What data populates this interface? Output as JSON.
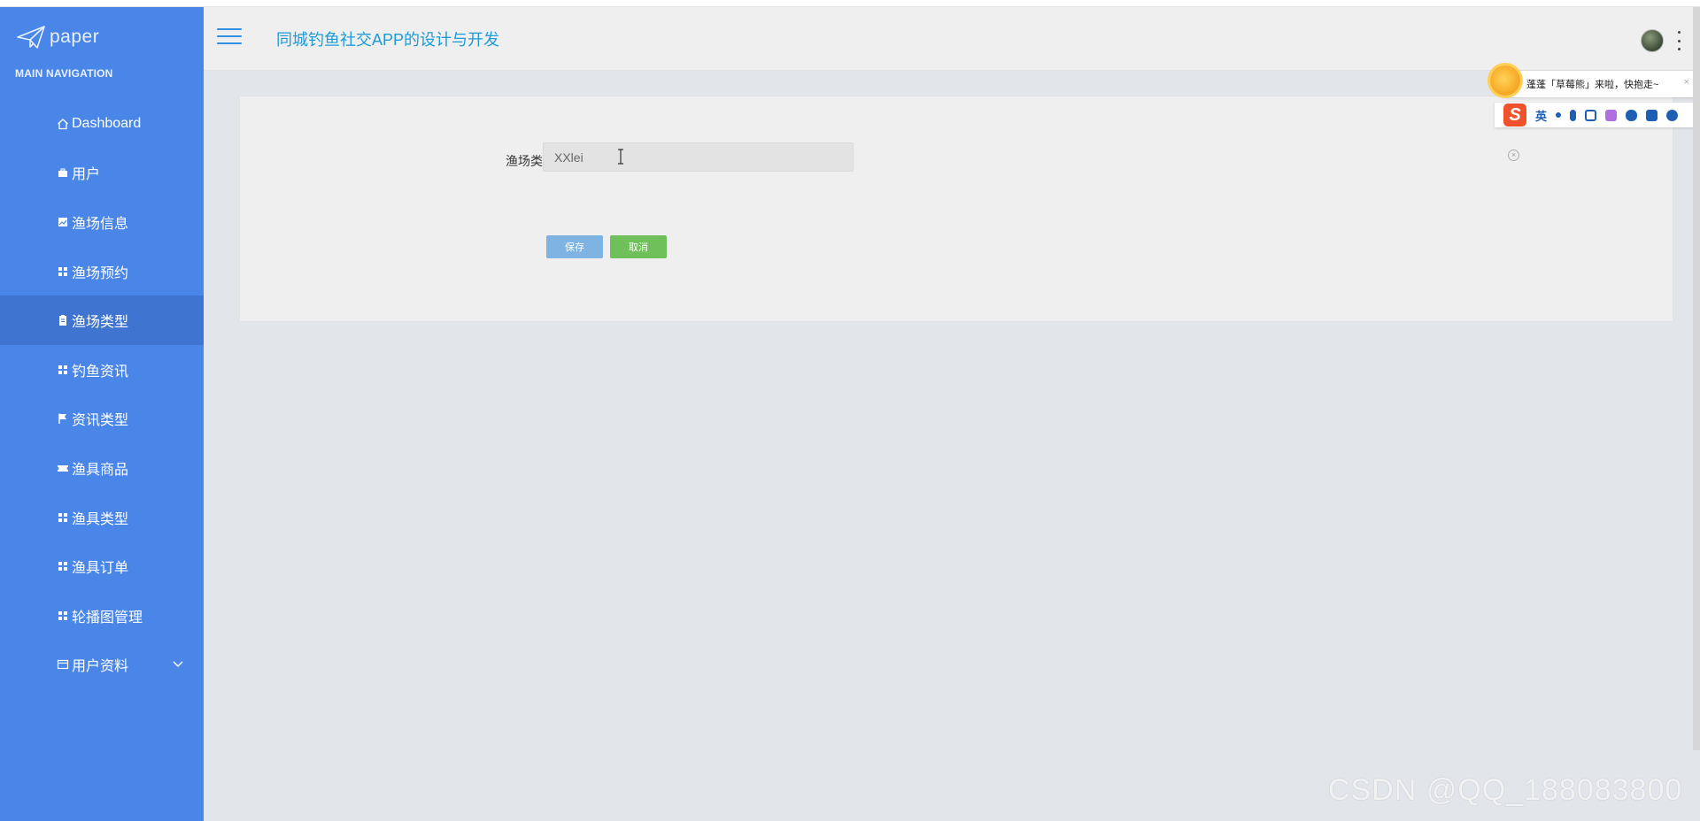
{
  "brand": {
    "name": "paper"
  },
  "sidebar": {
    "heading": "MAIN NAVIGATION",
    "items": [
      {
        "label": "Dashboard",
        "icon": "home-icon"
      },
      {
        "label": "用户",
        "icon": "user-icon"
      },
      {
        "label": "渔场信息",
        "icon": "image-icon"
      },
      {
        "label": "渔场预约",
        "icon": "grid-icon"
      },
      {
        "label": "渔场类型",
        "icon": "clipboard-icon",
        "active": true
      },
      {
        "label": "钓鱼资讯",
        "icon": "grid-icon"
      },
      {
        "label": "资讯类型",
        "icon": "flag-icon"
      },
      {
        "label": "渔具商品",
        "icon": "ticket-icon"
      },
      {
        "label": "渔具类型",
        "icon": "grid-icon"
      },
      {
        "label": "渔具订单",
        "icon": "grid-icon"
      },
      {
        "label": "轮播图管理",
        "icon": "grid-icon"
      },
      {
        "label": "用户资料",
        "icon": "card-icon",
        "expandable": true
      }
    ]
  },
  "header": {
    "title": "同城钓鱼社交APP的设计与开发"
  },
  "form": {
    "field_label": "渔场类型",
    "field_value": "XXlei",
    "save_label": "保存",
    "cancel_label": "取消"
  },
  "ime": {
    "tip_text": "蓬蓬「草莓熊」来啦，快抱走~",
    "close": "×",
    "lang": "英",
    "logo": "S"
  },
  "watermark": "CSDN @QQ_188083800",
  "colors": {
    "sidebar": "#4a86e8",
    "sidebar_active": "#3f74d1",
    "title": "#1e9bd7",
    "save_button": "#7fb4e2",
    "cancel_button": "#6fc05a"
  }
}
